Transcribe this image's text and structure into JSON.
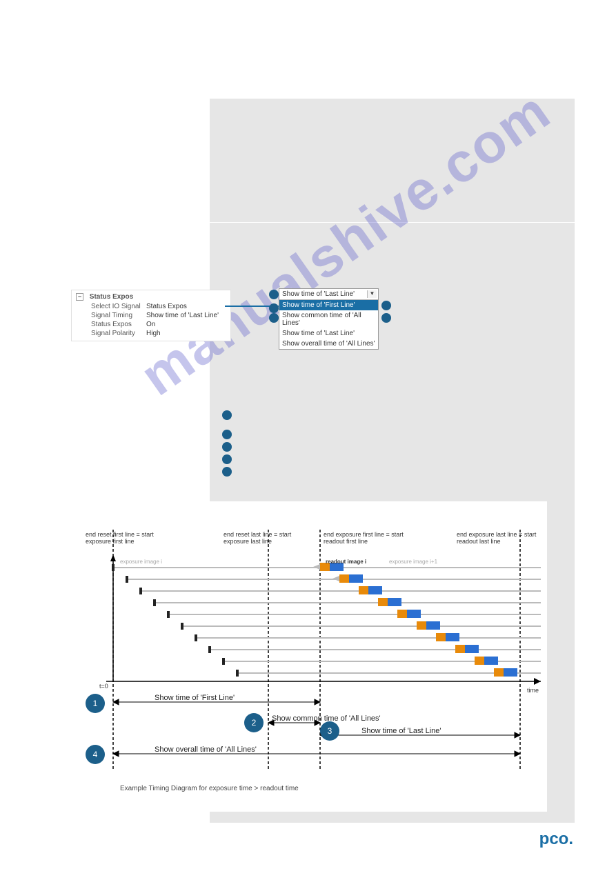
{
  "header": {
    "right_text": ""
  },
  "sidebar": {
    "panel_title": "Status Expos",
    "rows": [
      {
        "k": "Select IO Signal",
        "v": "Status Expos"
      },
      {
        "k": "Signal Timing",
        "v": "Show time of 'Last Line'"
      },
      {
        "k": "Status Expos",
        "v": "On"
      },
      {
        "k": "Signal Polarity",
        "v": "High"
      }
    ]
  },
  "dropdown": {
    "selected": "Show time of 'Last Line'",
    "options": [
      "Show time of 'First Line'",
      "Show common time of 'All Lines'",
      "Show time of 'Last Line'",
      "Show overall time of 'All Lines'"
    ],
    "highlighted_index": 0
  },
  "bullets": {
    "b1": "1",
    "b2": "2",
    "b3": "3",
    "b4": "4",
    "list": [
      "",
      "",
      "",
      ""
    ]
  },
  "diagram": {
    "top_labels": {
      "c1": "end reset first line =\nstart exposure first line",
      "c2": "end reset last line =\nstart exposure last line",
      "c3": "end exposure first line =\nstart readout first line",
      "c4": "end exposure last line =\nstart readout last line"
    },
    "band_labels": {
      "exp_i": "exposure image i",
      "readout": "readout image i",
      "exp_i1": "exposure image i+1"
    },
    "axis": {
      "t0": "t=0",
      "time": "time"
    },
    "annotations": {
      "first": "Show time of 'First Line'",
      "common": "Show common time of 'All Lines'",
      "last": "Show time of 'Last Line'",
      "overall": "Show overall time of 'All Lines'"
    },
    "caption": "Example Timing Diagram for exposure time > readout time"
  },
  "watermark": "manualshive.com",
  "footer": "pco.",
  "chart_data": {
    "type": "diagram",
    "description": "Rolling shutter timing diagram for exposure time > readout time",
    "time_axis_events": [
      {
        "id": "t0_reset_first",
        "label": "end reset first line = start exposure first line"
      },
      {
        "id": "t1_reset_last",
        "label": "end reset last line = start exposure last line"
      },
      {
        "id": "t2_readout_first",
        "label": "end exposure first line = start readout first line"
      },
      {
        "id": "t3_readout_last",
        "label": "end exposure last line = start readout last line"
      }
    ],
    "intervals": [
      {
        "id": 1,
        "name": "Show time of 'First Line'",
        "from": "t0_reset_first",
        "to": "t2_readout_first"
      },
      {
        "id": 2,
        "name": "Show common time of 'All Lines'",
        "from": "t1_reset_last",
        "to": "t2_readout_first"
      },
      {
        "id": 3,
        "name": "Show time of 'Last Line'",
        "from": "t1_reset_last",
        "to": "t3_readout_last"
      },
      {
        "id": 4,
        "name": "Show overall time of 'All Lines'",
        "from": "t0_reset_first",
        "to": "t3_readout_last"
      }
    ],
    "lines_shown": 10
  }
}
